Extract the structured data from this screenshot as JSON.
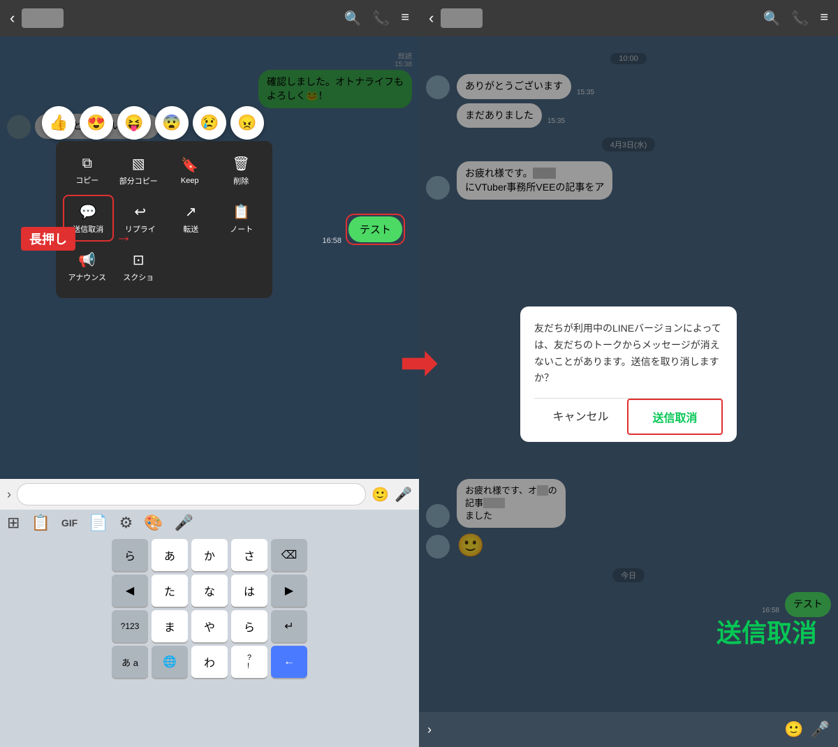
{
  "left": {
    "header": {
      "back": "‹",
      "name_placeholder": "",
      "icons": [
        "🔍",
        "📞",
        "≡"
      ]
    },
    "messages": [
      {
        "type": "right",
        "text": "確認しました。オトナライフも\nよろしく🐸！",
        "read": "既読",
        "time": "15:38"
      },
      {
        "type": "left",
        "text": "ありがとうございます！"
      }
    ],
    "emoji_reactions": [
      "👍",
      "😍",
      "😝",
      "😨",
      "😢",
      "😠"
    ],
    "context_menu": {
      "items_row1": [
        {
          "icon": "⧉",
          "label": "コピー"
        },
        {
          "icon": "▧",
          "label": "部分コピー"
        },
        {
          "icon": "🔖",
          "label": "Keep"
        },
        {
          "icon": "🗑",
          "label": "削除"
        }
      ],
      "items_row2": [
        {
          "icon": "💬",
          "label": "送信取消",
          "highlighted": true
        },
        {
          "icon": "↩",
          "label": "リプライ"
        },
        {
          "icon": "↗",
          "label": "転送"
        },
        {
          "icon": "📋",
          "label": "ノート"
        }
      ],
      "items_row3": [
        {
          "icon": "📢",
          "label": "アナウンス"
        },
        {
          "icon": "⊡",
          "label": "スクショ"
        }
      ]
    },
    "nagaoshi": "長押し",
    "test_message": "テスト",
    "test_time": "16:58",
    "input": {
      "placeholder": "|"
    },
    "keyboard": {
      "toolbar": [
        "⊞",
        "📋",
        "GIF",
        "📄",
        "⚙",
        "🎨",
        "🎤"
      ],
      "rows": [
        [
          "ら",
          "か",
          "さ"
        ],
        [
          "た",
          "な",
          "は"
        ],
        [
          "ま",
          "や",
          "ら"
        ],
        [
          "あ a",
          "わ",
          "?!,"
        ]
      ]
    }
  },
  "right": {
    "header": {
      "back": "‹",
      "name_placeholder": "",
      "icons": [
        "🔍",
        "📞",
        "≡"
      ]
    },
    "messages": [
      {
        "type": "left",
        "text": "ありがとうございます",
        "time": "15:35"
      },
      {
        "type": "left",
        "text": "まだありました",
        "time": "15:35"
      },
      {
        "date": "4月3日(水)"
      },
      {
        "type": "left_long",
        "text": "お疲れ様です。\nにVTuber事務所VEEの記事をア"
      },
      {
        "type": "right",
        "text": "テスト",
        "time": "16:58"
      }
    ],
    "dialog": {
      "text": "友だちが利用中のLINEバージョンによっては、友だちのトークからメッセージが消えないことがあります。送信を取り消しますか？",
      "cancel_label": "キャンセル",
      "confirm_label": "送信取消"
    },
    "soushin_label": "送信取消",
    "today_label": "今日",
    "bottom_sticker": "🙂"
  },
  "arrow": "➡"
}
